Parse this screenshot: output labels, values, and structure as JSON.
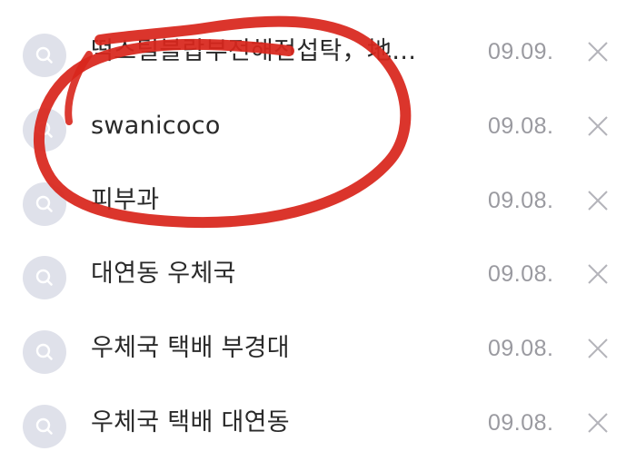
{
  "history": {
    "items": [
      {
        "label": "떡스틸블랍부전해전섭탁，地…",
        "date": "09.09."
      },
      {
        "label": "swanicoco",
        "date": "09.08."
      },
      {
        "label": "피부과",
        "date": "09.08."
      },
      {
        "label": "대연동 우체국",
        "date": "09.08."
      },
      {
        "label": "우체국 택배 부경대",
        "date": "09.08."
      },
      {
        "label": "우체국 택배 대연동",
        "date": "09.08."
      }
    ]
  },
  "icons": {
    "row_icon": "search-icon",
    "delete_icon": "close-icon"
  },
  "colors": {
    "annotation": "#d8261c",
    "icon_bg": "#dfe1ea",
    "date_text": "#9a9aa0"
  }
}
